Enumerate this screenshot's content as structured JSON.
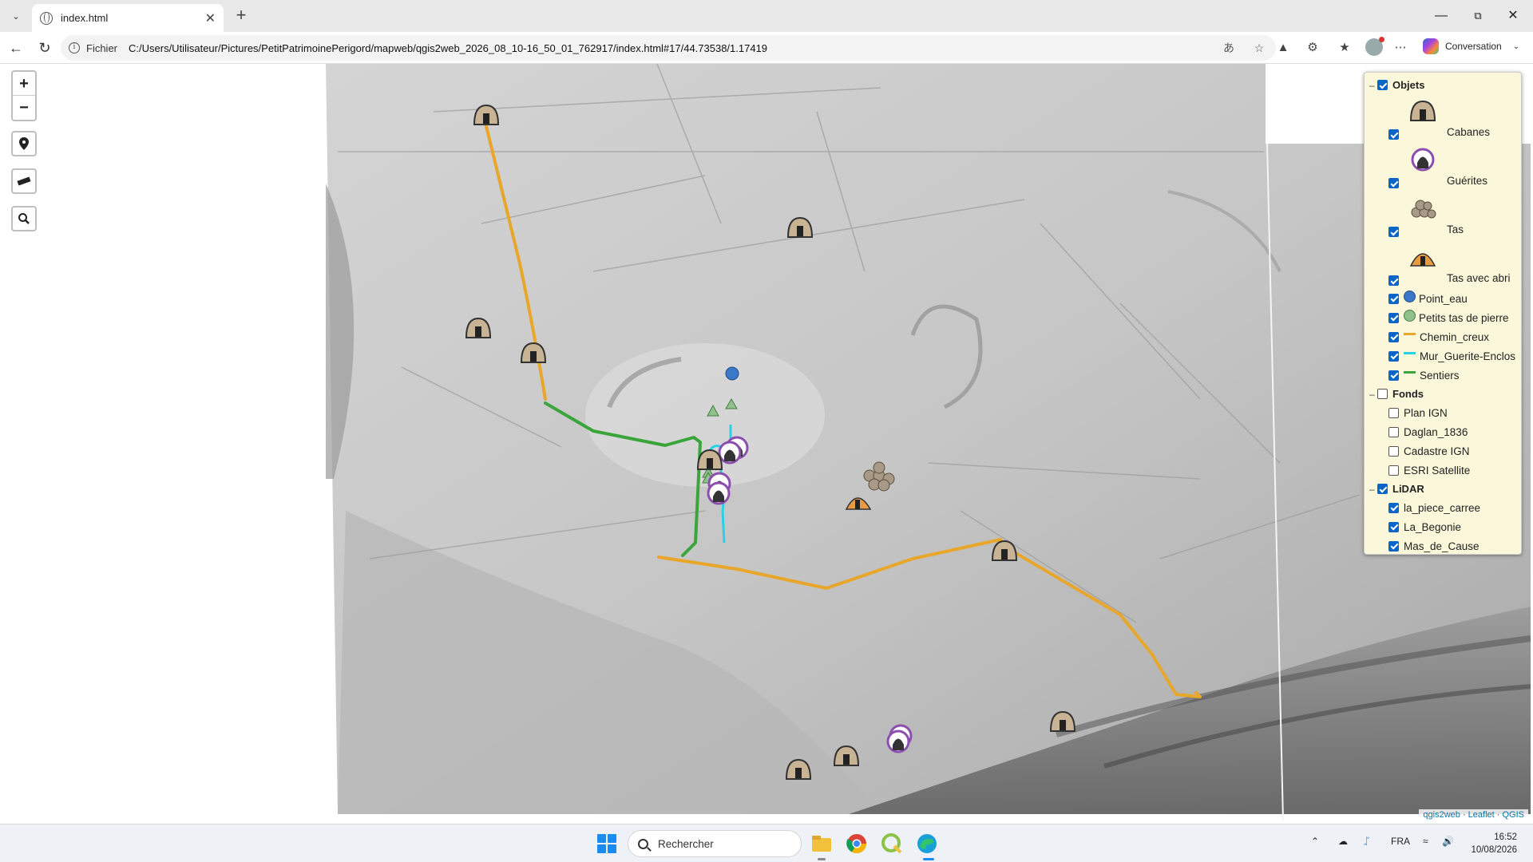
{
  "browser": {
    "tab_title": "index.html",
    "address_scheme": "Fichier",
    "address_url": "C:/Users/Utilisateur/Pictures/PetitPatrimoinePerigord/mapweb/qgis2web_2026_08_10-16_50_01_762917/index.html#17/44.73538/1.17419",
    "copilot_label": "Conversation",
    "icons": [
      "back-icon",
      "refresh-icon",
      "info-icon",
      "translate-icon",
      "star-icon",
      "extension-icon",
      "favorites-icon",
      "more-icon"
    ]
  },
  "map_controls": {
    "zoom_in": "+",
    "zoom_out": "−"
  },
  "layers": {
    "objets": {
      "label": "Objets",
      "checked": true,
      "items": [
        {
          "label": "Cabanes",
          "checked": true,
          "icon": "cabane-icon"
        },
        {
          "label": "Guérites",
          "checked": true,
          "icon": "guerite-icon"
        },
        {
          "label": "Tas",
          "checked": true,
          "icon": "tas-icon"
        },
        {
          "label": "Tas avec abri",
          "checked": true,
          "icon": "tas-abri-icon"
        },
        {
          "label": "Point_eau",
          "checked": true,
          "color": "#3c78c8"
        },
        {
          "label": "Petits tas de pierre",
          "checked": true,
          "color": "#8ec28a"
        },
        {
          "label": "Chemin_creux",
          "checked": true,
          "color": "#e8a72a"
        },
        {
          "label": "Mur_Guerite-Enclos",
          "checked": true,
          "color": "#28d2e6"
        },
        {
          "label": "Sentiers",
          "checked": true,
          "color": "#3aa53a"
        }
      ]
    },
    "fonds": {
      "label": "Fonds",
      "checked": false,
      "items": [
        {
          "label": "Plan IGN",
          "checked": false
        },
        {
          "label": "Daglan_1836",
          "checked": false
        },
        {
          "label": "Cadastre IGN",
          "checked": false
        },
        {
          "label": "ESRI Satellite",
          "checked": false
        }
      ]
    },
    "lidar": {
      "label": "LiDAR",
      "checked": true,
      "items": [
        {
          "label": "la_piece_carree",
          "checked": true
        },
        {
          "label": "La_Begonie",
          "checked": true
        },
        {
          "label": "Mas_de_Cause",
          "checked": true
        }
      ]
    }
  },
  "attribution": {
    "a": "qgis2web",
    "b": "Leaflet",
    "c": "QGIS",
    "sep": " · "
  },
  "taskbar": {
    "search_placeholder": "Rechercher",
    "lang": "FRA",
    "time": "16:52",
    "date": "10/08/2026"
  }
}
